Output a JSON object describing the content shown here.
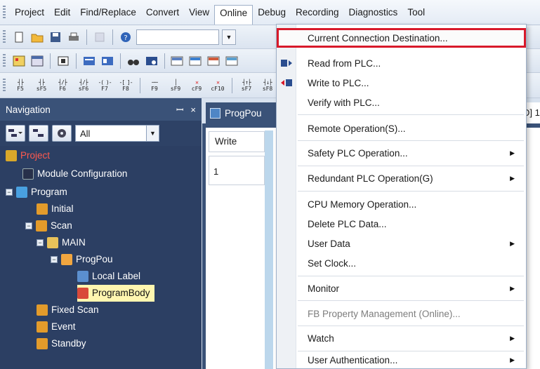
{
  "menubar": {
    "items": [
      "Project",
      "Edit",
      "Find/Replace",
      "Convert",
      "View",
      "Online",
      "Debug",
      "Recording",
      "Diagnostics",
      "Tool"
    ]
  },
  "toolbar3": {
    "ladder_symbols": [
      "F5",
      "sF5",
      "F6",
      "sF6",
      "F7",
      "F8",
      "F9",
      "sF9",
      "cF9",
      "cF10",
      "sF7",
      "sF8"
    ]
  },
  "navigation": {
    "title": "Navigation",
    "pin": "ꟷ",
    "close": "×",
    "filter_value": "All",
    "tree": [
      {
        "label": "Project",
        "icon": "project-icon"
      },
      {
        "label": "Module Configuration",
        "icon": "module-config-icon"
      },
      {
        "label": "Program",
        "icon": "program-folder-icon"
      },
      {
        "label": "Initial",
        "icon": "task-icon"
      },
      {
        "label": "Scan",
        "icon": "task-icon"
      },
      {
        "label": "MAIN",
        "icon": "program-icon"
      },
      {
        "label": "ProgPou",
        "icon": "pou-icon"
      },
      {
        "label": "Local Label",
        "icon": "local-label-icon"
      },
      {
        "label": "ProgramBody",
        "icon": "program-body-icon"
      },
      {
        "label": "Fixed Scan",
        "icon": "task-icon"
      },
      {
        "label": "Event",
        "icon": "task-icon"
      },
      {
        "label": "Standby",
        "icon": "task-icon"
      }
    ]
  },
  "editor": {
    "tab_label": "ProgPou",
    "column_header": "Write",
    "row_number": "1",
    "right_fragment": "D] 1"
  },
  "online_menu": {
    "items": [
      {
        "label": "Current Connection Destination...",
        "icon": "",
        "submenu": false,
        "disabled": false,
        "highlight": true
      },
      {
        "label": "Read from PLC...",
        "icon": "read-plc-icon",
        "submenu": false,
        "disabled": false
      },
      {
        "label": "Write to PLC...",
        "icon": "write-plc-icon",
        "submenu": false,
        "disabled": false
      },
      {
        "label": "Verify with PLC...",
        "icon": "",
        "submenu": false,
        "disabled": false
      },
      {
        "label": "Remote Operation(S)...",
        "icon": "",
        "submenu": false,
        "disabled": false
      },
      {
        "label": "Safety PLC Operation...",
        "icon": "",
        "submenu": true,
        "disabled": false
      },
      {
        "label": "Redundant PLC Operation(G)",
        "icon": "",
        "submenu": true,
        "disabled": false
      },
      {
        "label": "CPU Memory Operation...",
        "icon": "",
        "submenu": false,
        "disabled": false
      },
      {
        "label": "Delete PLC Data...",
        "icon": "",
        "submenu": false,
        "disabled": false
      },
      {
        "label": "User Data",
        "icon": "",
        "submenu": true,
        "disabled": false
      },
      {
        "label": "Set Clock...",
        "icon": "",
        "submenu": false,
        "disabled": false
      },
      {
        "label": "Monitor",
        "icon": "",
        "submenu": true,
        "disabled": false
      },
      {
        "label": "FB Property Management (Online)...",
        "icon": "",
        "submenu": false,
        "disabled": true
      },
      {
        "label": "Watch",
        "icon": "",
        "submenu": true,
        "disabled": false
      },
      {
        "label": "User Authentication...",
        "icon": "",
        "submenu": true,
        "disabled": false
      }
    ]
  },
  "colors": {
    "highlight_border": "#d8192a",
    "nav_background": "#2c3f63",
    "selected_row": "#fff6b0"
  }
}
